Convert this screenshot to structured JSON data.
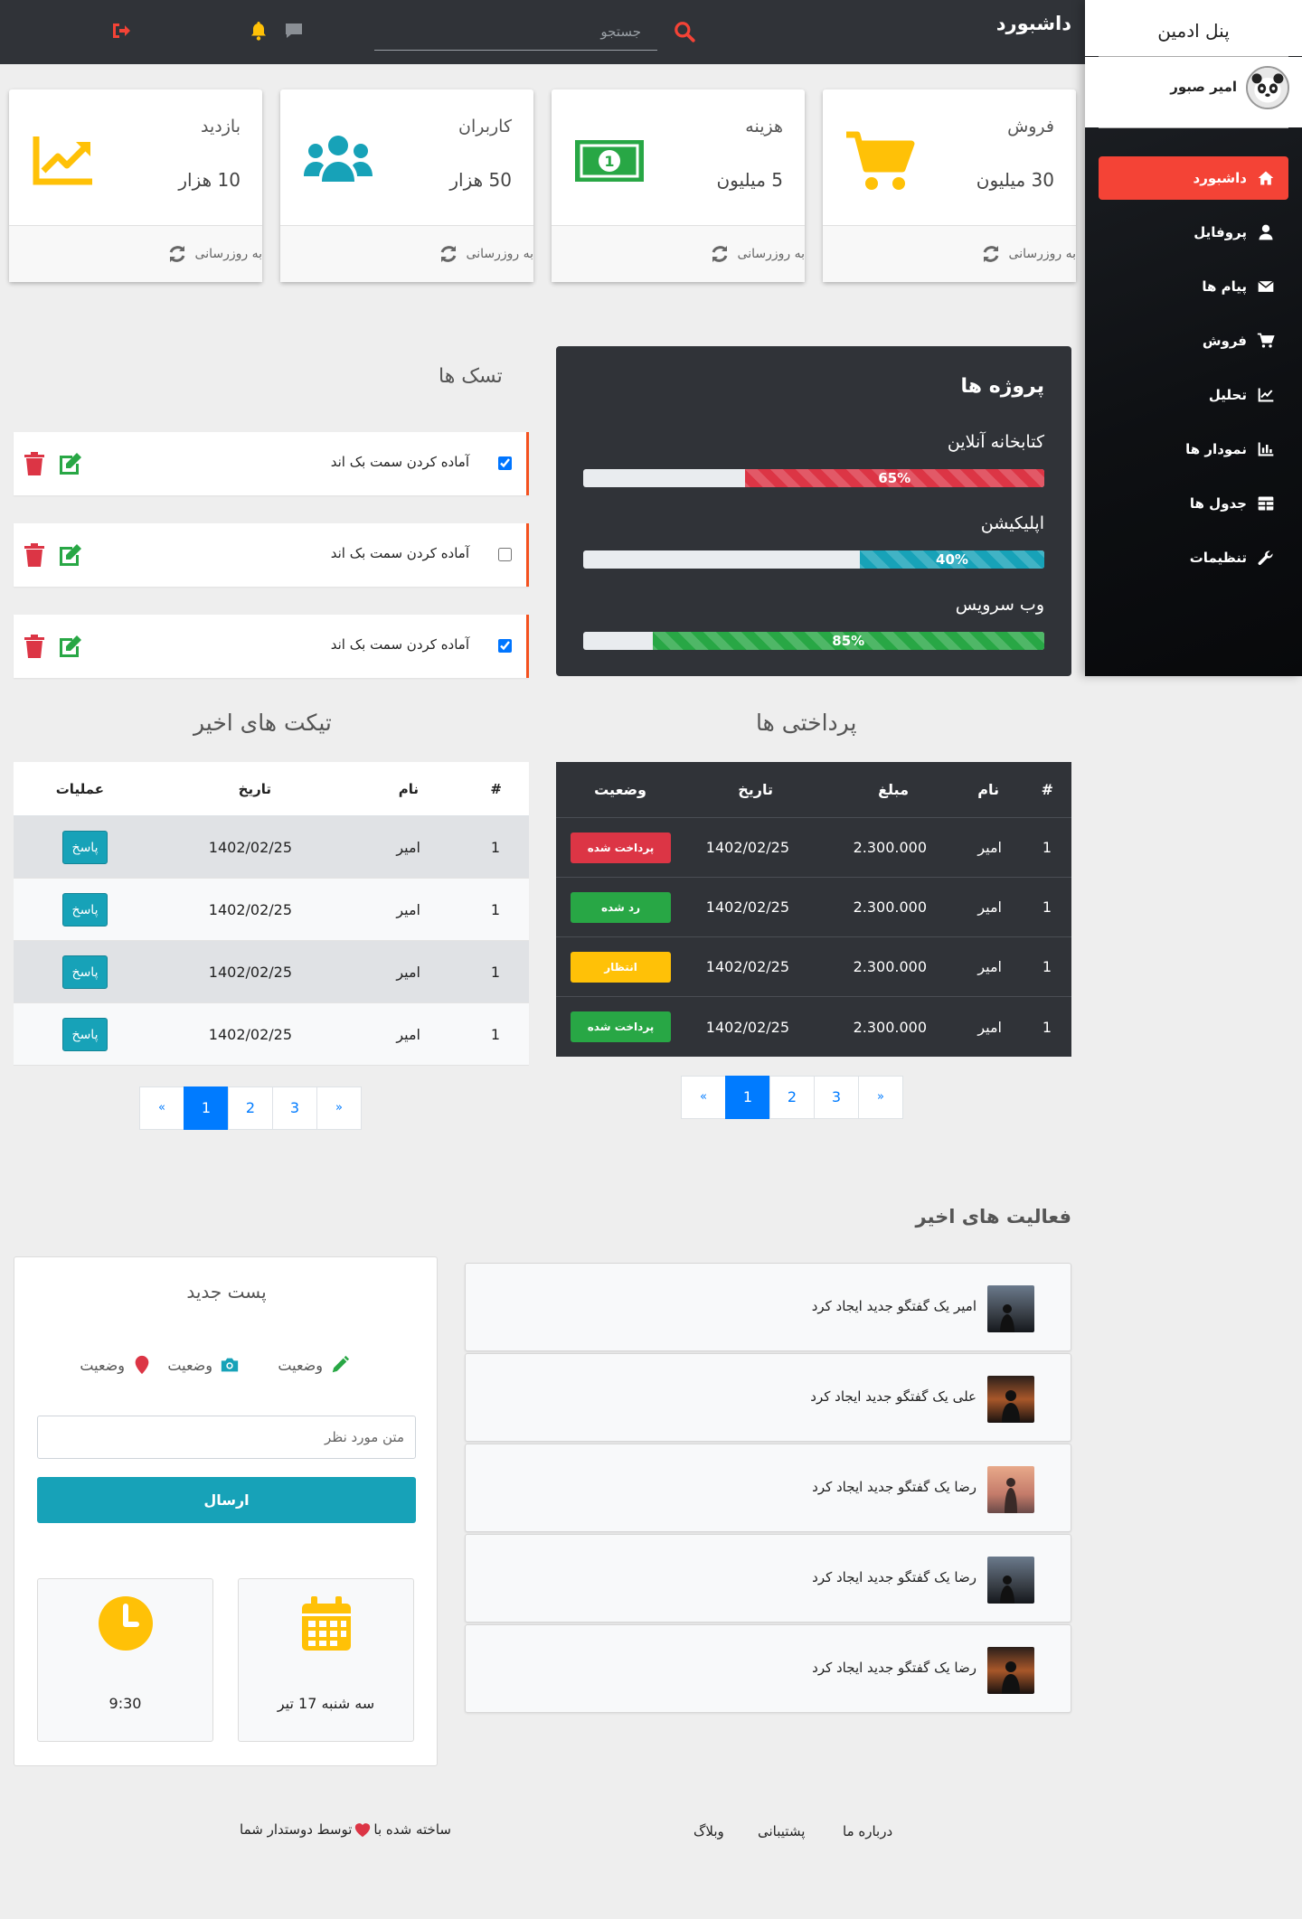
{
  "header": {
    "title": "داشبورد",
    "search_placeholder": "جستجو"
  },
  "sidebar": {
    "brand": "پنل ادمین",
    "user_name": "امیر صبور",
    "items": [
      {
        "label": "داشبورد",
        "icon": "home-icon",
        "active": true
      },
      {
        "label": "پروفایل",
        "icon": "user-icon"
      },
      {
        "label": "پیام ها",
        "icon": "envelope-icon"
      },
      {
        "label": "فروش",
        "icon": "cart-icon"
      },
      {
        "label": "تحلیل",
        "icon": "line-chart-icon"
      },
      {
        "label": "نمودار ها",
        "icon": "bar-chart-icon"
      },
      {
        "label": "جدول ها",
        "icon": "table-icon"
      },
      {
        "label": "تنظیمات",
        "icon": "wrench-icon"
      }
    ]
  },
  "stats": [
    {
      "title": "فروش",
      "value": "30 میلیون",
      "icon": "cart-icon",
      "color": "#ffc107",
      "footer": "به روزرسانی"
    },
    {
      "title": "هزینه",
      "value": "5 میلیون",
      "icon": "money-icon",
      "color": "#28a745",
      "footer": "به روزرسانی"
    },
    {
      "title": "کاربران",
      "value": "50 هزار",
      "icon": "users-icon",
      "color": "#17a2b8",
      "footer": "به روزرسانی"
    },
    {
      "title": "بازدید",
      "value": "10 هزار",
      "icon": "trend-icon",
      "color": "#ffc107",
      "footer": "به روزرسانی"
    }
  ],
  "projects": {
    "title": "پروژه ها",
    "items": [
      {
        "name": "کتابخانه آنلاین",
        "percent": 65,
        "label": "65%",
        "color": "red"
      },
      {
        "name": "اپلیکیشن",
        "percent": 40,
        "label": "40%",
        "color": "blue"
      },
      {
        "name": "وب سرویس",
        "percent": 85,
        "label": "85%",
        "color": "green"
      }
    ]
  },
  "tasks": {
    "title": "تسک ها",
    "items": [
      {
        "text": "آماده کردن سمت بک اند",
        "checked": true
      },
      {
        "text": "آماده کردن سمت بک اند",
        "checked": false
      },
      {
        "text": "آماده کردن سمت بک اند",
        "checked": true
      }
    ]
  },
  "payments": {
    "title": "پرداختی ها",
    "headers": [
      "#",
      "نام",
      "مبلغ",
      "تاریخ",
      "وضعیت"
    ],
    "rows": [
      {
        "num": "1",
        "name": "امیر",
        "amount": "2.300.000",
        "date": "1402/02/25",
        "status": "پرداخت شده",
        "status_color": "#dc3545"
      },
      {
        "num": "1",
        "name": "امیر",
        "amount": "2.300.000",
        "date": "1402/02/25",
        "status": "رد شده",
        "status_color": "#28a745"
      },
      {
        "num": "1",
        "name": "امیر",
        "amount": "2.300.000",
        "date": "1402/02/25",
        "status": "انتظار",
        "status_color": "#ffc107"
      },
      {
        "num": "1",
        "name": "امیر",
        "amount": "2.300.000",
        "date": "1402/02/25",
        "status": "پرداخت شده",
        "status_color": "#28a745"
      }
    ],
    "pages": [
      "«",
      "1",
      "2",
      "3",
      "»"
    ]
  },
  "tickets": {
    "title": "تیکت های اخیر",
    "headers": [
      "#",
      "نام",
      "تاریخ",
      "عملیات"
    ],
    "rows": [
      {
        "num": "1",
        "name": "امیر",
        "date": "1402/02/25",
        "action": "پاسخ"
      },
      {
        "num": "1",
        "name": "امیر",
        "date": "1402/02/25",
        "action": "پاسخ"
      },
      {
        "num": "1",
        "name": "امیر",
        "date": "1402/02/25",
        "action": "پاسخ"
      },
      {
        "num": "1",
        "name": "امیر",
        "date": "1402/02/25",
        "action": "پاسخ"
      }
    ],
    "pages": [
      "«",
      "1",
      "2",
      "3",
      "»"
    ]
  },
  "activities": {
    "title": "فعالیت های اخیر",
    "items": [
      {
        "text": "امیر یک گفتگو جدید ایجاد کرد"
      },
      {
        "text": "علی یک گفتگو جدید ایجاد کرد"
      },
      {
        "text": "رضا یک گفتگو جدید ایجاد کرد"
      },
      {
        "text": "رضا یک گفتگو جدید ایجاد کرد"
      },
      {
        "text": "رضا یک گفتگو جدید ایجاد کرد"
      }
    ]
  },
  "new_post": {
    "title": "پست جدید",
    "statuses": [
      {
        "label": "وضعیت",
        "icon": "pencil-icon",
        "color": "#28a745"
      },
      {
        "label": "وضعیت",
        "icon": "camera-icon",
        "color": "#17a2b8"
      },
      {
        "label": "وضعیت",
        "icon": "map-pin-icon",
        "color": "#dc3545"
      }
    ],
    "input_placeholder": "متن مورد نظر",
    "send_label": "ارسال",
    "date_text": "سه شنبه 17 تیر",
    "time_text": "9:30"
  },
  "footer": {
    "links": [
      "درباره ما",
      "پشتیبانی",
      "وبلاگ"
    ],
    "made_before": "ساخته شده با",
    "made_after": "توسط دوستدار شما"
  }
}
